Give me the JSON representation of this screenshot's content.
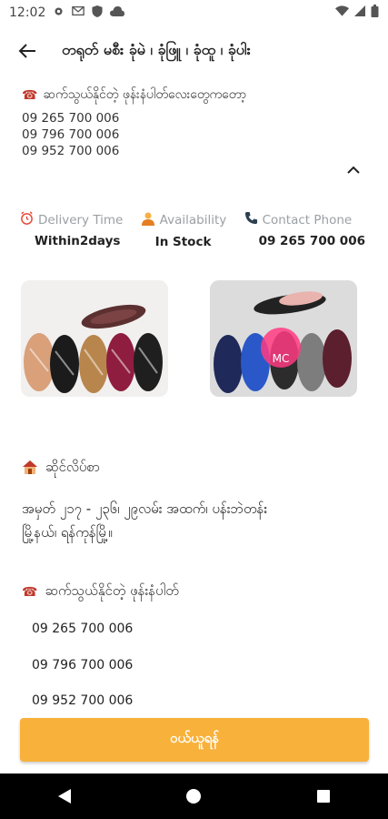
{
  "status": {
    "time": "12:02"
  },
  "app_bar": {
    "title": "တရုတ် မစီး ခုံမဲ ၊ ခုံဖြူ ၊ ခုံထူ ၊ ခုံပါး"
  },
  "contact_top": {
    "heading": "ဆက်သွယ်နိုင်တဲ့ ဖုန်းနံပါတ်လေးတွေကတော့",
    "phones": [
      "09 265 700 006",
      "09 796 700 006",
      "09 952 700 006"
    ]
  },
  "info": {
    "delivery_label": "Delivery Time",
    "delivery_value": "Within2days",
    "availability_label": "Availability",
    "availability_value": "In Stock",
    "contact_label": "Contact Phone",
    "contact_value": "09 265 700 006"
  },
  "photos": {
    "right_watermark": "MC"
  },
  "address": {
    "heading": "ဆိုင်လိပ်စာ",
    "line1": "အမှတ် ၂၁၇ - ၂၃၆၊ ၂၉လမ်း အထက်၊ ပန်းဘဲတန်း",
    "line2": "မြို့နယ်၊ ရန်ကုန်မြို့။"
  },
  "contact_bottom": {
    "heading": "ဆက်သွယ်နိုင်တဲ့ ဖုန်းနံပါတ်",
    "phones": [
      "09 265 700 006",
      "09 796 700 006",
      "09 952 700 006"
    ]
  },
  "buy_button": {
    "label": "ဝယ်ယူရန်",
    "color": "#f8b13a"
  }
}
